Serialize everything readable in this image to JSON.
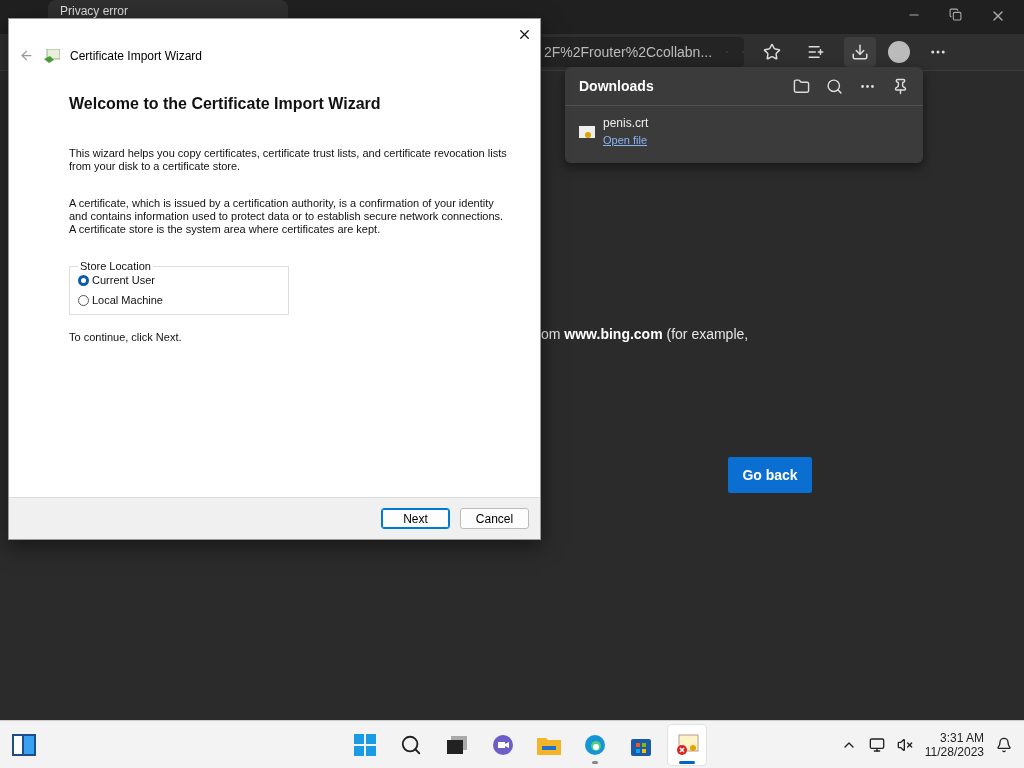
{
  "browser": {
    "tab": {
      "title": "Privacy error"
    },
    "address": "2F%2Frouter%2Ccollabn...",
    "downloads": {
      "title": "Downloads",
      "items": [
        {
          "name": "penis.crt",
          "action": "Open file"
        }
      ]
    },
    "page": {
      "text": "om **www.bing.com** (for example,",
      "button": "Go back"
    }
  },
  "wizard": {
    "title": "Certificate Import Wizard",
    "heading": "Welcome to the Certificate Import Wizard",
    "paragraphs": [
      "This wizard helps you copy certificates, certificate trust lists, and certificate revocation lists from your disk to a certificate store.",
      "A certificate, which is issued by a certification authority, is a confirmation of your identity and contains information used to protect data or to establish secure network connections. A certificate store is the system area where certificates are kept."
    ],
    "store": {
      "legend": "Store Location",
      "options": [
        {
          "label": "Current User",
          "selected": true
        },
        {
          "label": "Local Machine",
          "selected": false
        }
      ]
    },
    "hint": "To continue, click Next.",
    "buttons": [
      {
        "label": "Next",
        "default": true
      },
      {
        "label": "Cancel",
        "default": false
      }
    ]
  },
  "taskbar": {
    "apps": [
      {
        "kind": "search",
        "running": false,
        "active": false
      },
      {
        "kind": "taskview",
        "running": false,
        "active": false
      },
      {
        "kind": "chat",
        "running": false,
        "active": false
      },
      {
        "kind": "files",
        "running": false,
        "active": false
      },
      {
        "kind": "edge",
        "running": true,
        "active": false
      },
      {
        "kind": "store",
        "running": false,
        "active": false
      },
      {
        "kind": "cert",
        "running": true,
        "active": true
      }
    ],
    "time": "3:31 AM",
    "date": "11/28/2023"
  }
}
